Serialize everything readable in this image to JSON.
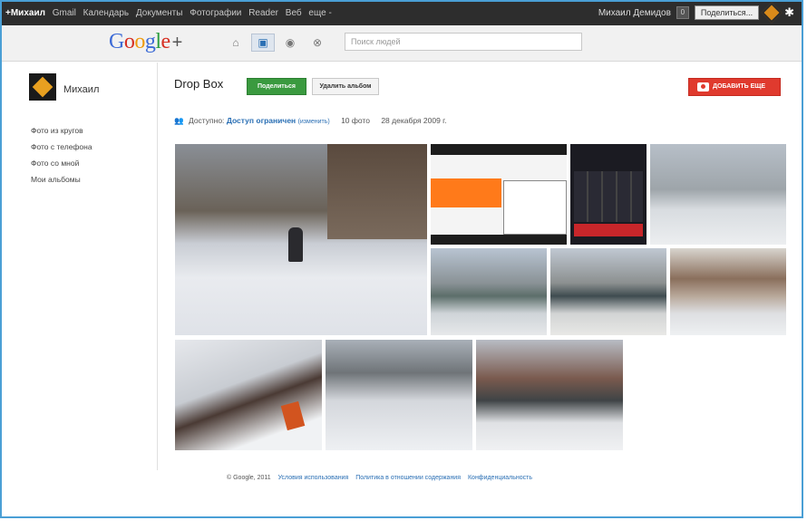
{
  "topbar": {
    "links": [
      "+Михаил",
      "Gmail",
      "Календарь",
      "Документы",
      "Фотографии",
      "Reader",
      "Веб",
      "еще -"
    ],
    "user_name": "Михаил Демидов",
    "notif_count": "0",
    "share_label": "Поделиться...",
    "gear_icon": "gear-icon"
  },
  "header": {
    "logo_letters": [
      "G",
      "o",
      "o",
      "g",
      "l",
      "e"
    ],
    "logo_plus": "+",
    "search_placeholder": "Поиск людей"
  },
  "sidebar": {
    "profile_name": "Михаил",
    "items": [
      "Фото из кругов",
      "Фото с телефона",
      "Фото со мной",
      "Мои альбомы"
    ]
  },
  "album": {
    "title": "Drop Box",
    "share_button": "Поделиться",
    "delete_button": "Удалить альбом",
    "add_button": "ДОБАВИТЬ ЕЩЕ",
    "access_label": "Доступно:",
    "access_value": "Доступ ограничен",
    "access_change": "(изменить)",
    "photo_count": "10 фото",
    "date": "28 декабря 2009 г."
  },
  "footer": {
    "copyright": "© Google, 2011",
    "links": [
      "Условия использования",
      "Политика в отношении содержания",
      "Конфиденциальность"
    ]
  },
  "colors": {
    "accent_blue": "#2a6fb4",
    "share_green": "#3a9a3f",
    "add_red": "#e03a2e",
    "frame_border": "#4a9fd5"
  }
}
